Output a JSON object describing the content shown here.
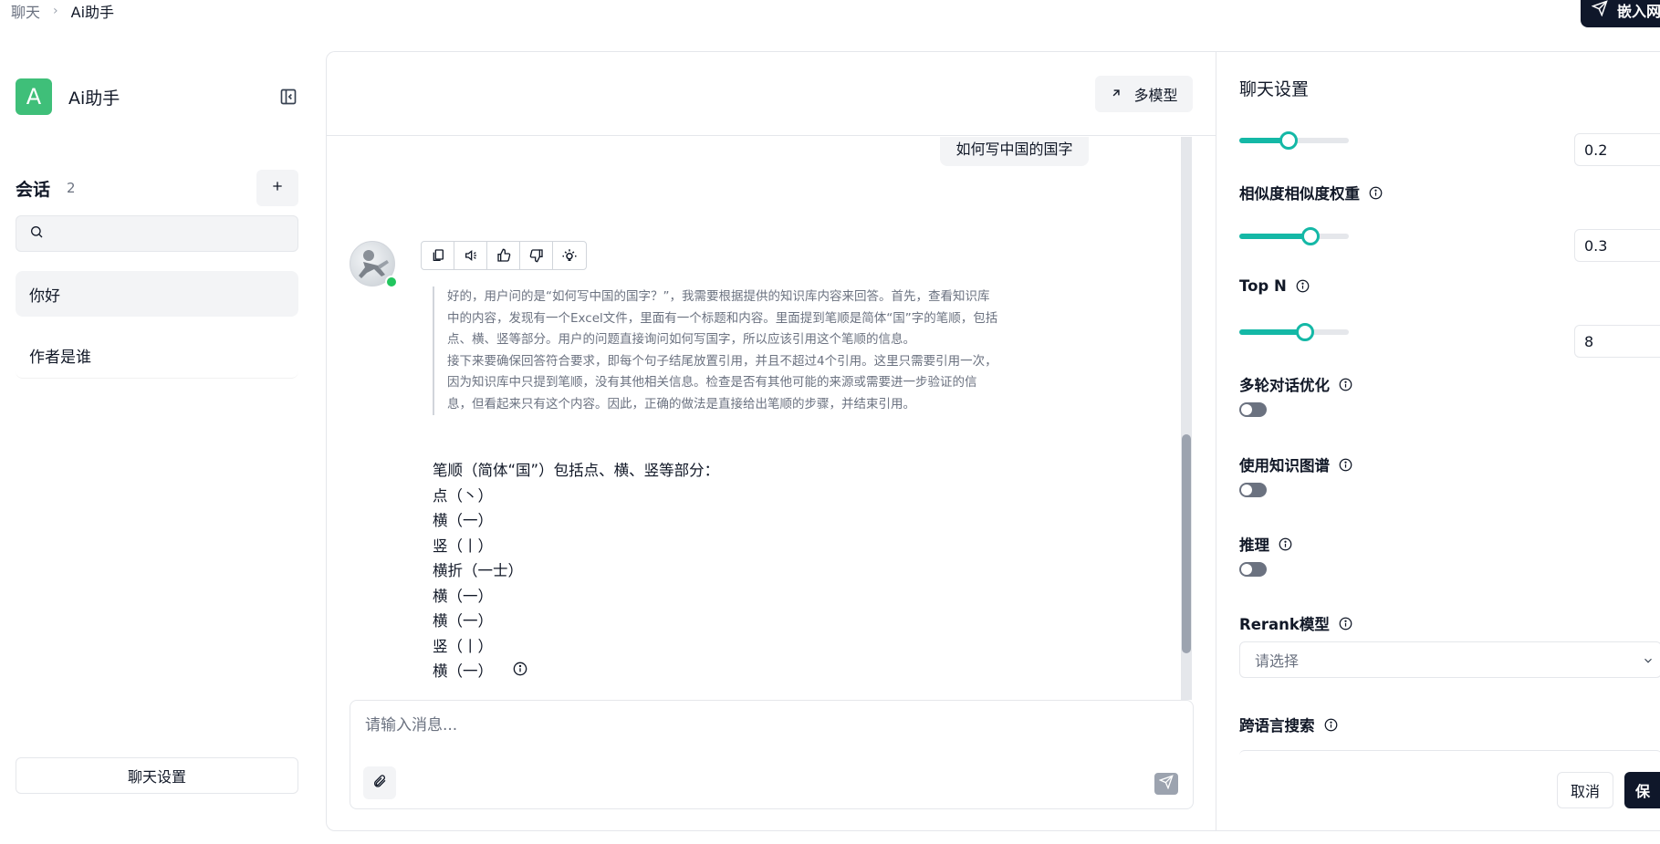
{
  "breadcrumb": {
    "parent": "聊天",
    "separator": "›",
    "current": "Ai助手"
  },
  "header": {
    "embed_label": "嵌入网"
  },
  "sidebar": {
    "app_initial": "A",
    "app_name": "Ai助手",
    "conversations_title": "会话",
    "conversations_count": "2",
    "search_placeholder": "",
    "items": [
      {
        "label": "你好",
        "active": true
      },
      {
        "label": "作者是谁",
        "active": false
      }
    ],
    "settings_button": "聊天设置"
  },
  "chat": {
    "multi_model_label": "多模型",
    "user_message": "如何写中国的国字",
    "thinking": [
      "好的，用户问的是“如何写中国的国字？”，我需要根据提供的知识库内容来回答。首先，查看知识库中的内容，发现有一个Excel文件，里面有一个标题和内容。里面提到笔顺是简体“国”字的笔顺，包括点、横、竖等部分。用户的问题直接询问如何写国字，所以应该引用这个笔顺的信息。",
      "接下来要确保回答符合要求，即每个句子结尾放置引用，并且不超过4个引用。这里只需要引用一次，因为知识库中只提到笔顺，没有其他相关信息。检查是否有其他可能的来源或需要进一步验证的信息，但看起来只有这个内容。因此，正确的做法是直接给出笔顺的步骤，并结束引用。"
    ],
    "answer_lines": [
      "笔顺（简体“国”）包括点、横、竖等部分：",
      "点（丶）",
      "横（一）",
      "竖（丨）",
      "横折（一士）",
      "横（一）",
      "横（一）",
      "竖（丨）",
      "横（一）"
    ],
    "composer_placeholder": "请输入消息..."
  },
  "settings": {
    "title": "聊天设置",
    "accent_color": "#14b8a6",
    "params": [
      {
        "label": "",
        "value": "0.2",
        "fraction": 0.45
      },
      {
        "label": "相似度相似度权重",
        "value": "0.3",
        "fraction": 0.65
      },
      {
        "label": "Top N",
        "value": "8",
        "fraction": 0.6
      }
    ],
    "toggles": [
      {
        "label": "多轮对话优化",
        "on": false
      },
      {
        "label": "使用知识图谱",
        "on": false
      },
      {
        "label": "推理",
        "on": false
      }
    ],
    "rerank_label": "Rerank模型",
    "rerank_placeholder": "请选择",
    "cross_lang_label": "跨语言搜索",
    "cancel_label": "取消",
    "save_label": "保"
  }
}
